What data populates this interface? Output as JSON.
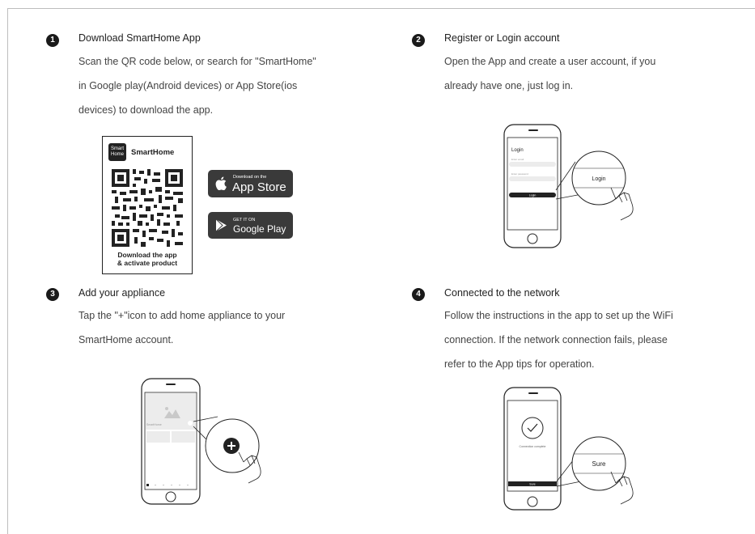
{
  "steps": [
    {
      "number": "1",
      "title": "Download SmartHome App",
      "body": [
        "Scan the QR code below, or search for \"SmartHome\"",
        "in Google play(Android devices) or App Store(ios",
        "devices) to download the app."
      ]
    },
    {
      "number": "2",
      "title": "Register or Login account",
      "body": [
        "Open the App and create a user account, if you",
        "already have one, just log in."
      ]
    },
    {
      "number": "3",
      "title": "Add your appliance",
      "body": [
        "Tap the \"+\"icon to add home appliance to your",
        "SmartHome account."
      ]
    },
    {
      "number": "4",
      "title": "Connected to the network",
      "body": [
        "Follow the instructions in the app to set up the WiFi",
        "connection. If the network connection fails, please",
        "refer to the App tips for operation."
      ]
    }
  ],
  "qr_card": {
    "logo_line1": "Smart",
    "logo_line2": "Home",
    "brand": "SmartHome",
    "caption_line1": "Download the app",
    "caption_line2": "& activate product"
  },
  "app_store": {
    "small": "Download on the",
    "big": "App Store"
  },
  "google_play": {
    "small": "GET IT ON",
    "big": "Google Play"
  },
  "login_phone": {
    "title": "Login",
    "email_placeholder": "Enter email",
    "password_placeholder": "Enter password",
    "button": "Login",
    "zoom_label": "Login"
  },
  "add_phone": {
    "card_label": "SmartHome"
  },
  "network_phone": {
    "status": "Connection complete",
    "button": "Sure",
    "zoom_label": "Sure"
  },
  "colors": {
    "ink": "#222222",
    "badge": "#3a3a3a",
    "text": "#444444"
  }
}
